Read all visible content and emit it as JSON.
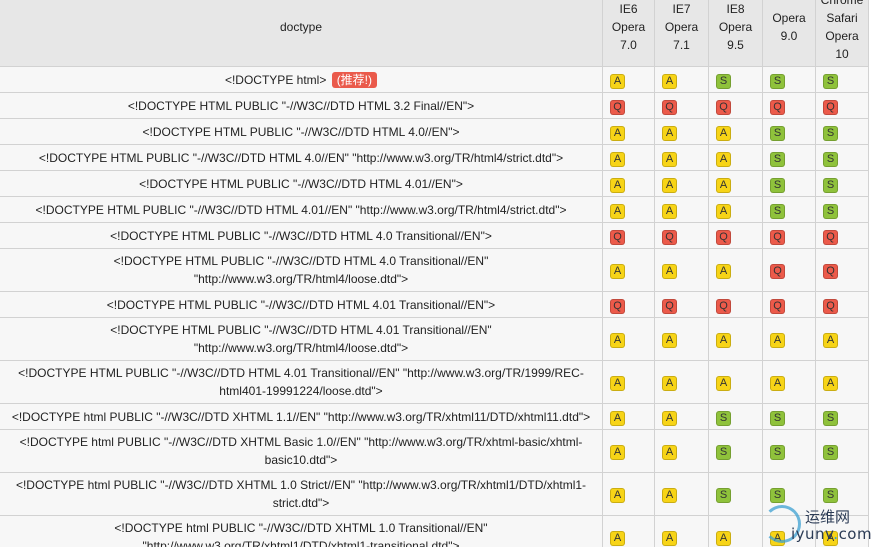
{
  "header": {
    "doctype": "doctype",
    "browsers": [
      {
        "top": "IE6",
        "line1": "Opera",
        "line2": "7.0",
        "line3": ""
      },
      {
        "top": "IE7",
        "line1": "Opera",
        "line2": "7.1",
        "line3": ""
      },
      {
        "top": "IE8",
        "line1": "Opera",
        "line2": "9.5",
        "line3": ""
      },
      {
        "top": "",
        "line1": "Opera",
        "line2": "9.0",
        "line3": ""
      },
      {
        "top": "Chrome",
        "line1": "Safari",
        "line2": "Opera",
        "line3": "10"
      }
    ]
  },
  "recommend_badge": "(推荐!)",
  "rows": [
    {
      "doctype": "<!DOCTYPE html>",
      "recommended": true,
      "modes": [
        "A",
        "A",
        "S",
        "S",
        "S"
      ]
    },
    {
      "doctype": "<!DOCTYPE HTML PUBLIC \"-//W3C//DTD HTML 3.2 Final//EN\">",
      "modes": [
        "Q",
        "Q",
        "Q",
        "Q",
        "Q"
      ]
    },
    {
      "doctype": "<!DOCTYPE HTML PUBLIC \"-//W3C//DTD HTML 4.0//EN\">",
      "modes": [
        "A",
        "A",
        "A",
        "S",
        "S"
      ]
    },
    {
      "doctype": "<!DOCTYPE HTML PUBLIC \"-//W3C//DTD HTML 4.0//EN\" \"http://www.w3.org/TR/html4/strict.dtd\">",
      "modes": [
        "A",
        "A",
        "A",
        "S",
        "S"
      ]
    },
    {
      "doctype": "<!DOCTYPE HTML PUBLIC \"-//W3C//DTD HTML 4.01//EN\">",
      "modes": [
        "A",
        "A",
        "A",
        "S",
        "S"
      ]
    },
    {
      "doctype": "<!DOCTYPE HTML PUBLIC \"-//W3C//DTD HTML 4.01//EN\" \"http://www.w3.org/TR/html4/strict.dtd\">",
      "modes": [
        "A",
        "A",
        "A",
        "S",
        "S"
      ]
    },
    {
      "doctype": "<!DOCTYPE HTML PUBLIC \"-//W3C//DTD HTML 4.0 Transitional//EN\">",
      "modes": [
        "Q",
        "Q",
        "Q",
        "Q",
        "Q"
      ]
    },
    {
      "doctype": "<!DOCTYPE HTML PUBLIC \"-//W3C//DTD HTML 4.0 Transitional//EN\" \"http://www.w3.org/TR/html4/loose.dtd\">",
      "doctype_lines": [
        "<!DOCTYPE HTML PUBLIC \"-//W3C//DTD HTML 4.0 Transitional//EN\"",
        "\"http://www.w3.org/TR/html4/loose.dtd\">"
      ],
      "modes": [
        "A",
        "A",
        "A",
        "Q",
        "Q"
      ]
    },
    {
      "doctype": "<!DOCTYPE HTML PUBLIC \"-//W3C//DTD HTML 4.01 Transitional//EN\">",
      "modes": [
        "Q",
        "Q",
        "Q",
        "Q",
        "Q"
      ]
    },
    {
      "doctype": "<!DOCTYPE HTML PUBLIC \"-//W3C//DTD HTML 4.01 Transitional//EN\" \"http://www.w3.org/TR/html4/loose.dtd\">",
      "doctype_lines": [
        "<!DOCTYPE HTML PUBLIC \"-//W3C//DTD HTML 4.01 Transitional//EN\"",
        "\"http://www.w3.org/TR/html4/loose.dtd\">"
      ],
      "modes": [
        "A",
        "A",
        "A",
        "A",
        "A"
      ]
    },
    {
      "doctype": "<!DOCTYPE HTML PUBLIC \"-//W3C//DTD HTML 4.01 Transitional//EN\" \"http://www.w3.org/TR/1999/REC-html401-19991224/loose.dtd\">",
      "doctype_lines": [
        "<!DOCTYPE HTML PUBLIC \"-//W3C//DTD HTML 4.01 Transitional//EN\" \"http://www.w3.org/TR/1999/REC-",
        "html401-19991224/loose.dtd\">"
      ],
      "modes": [
        "A",
        "A",
        "A",
        "A",
        "A"
      ]
    },
    {
      "doctype": "<!DOCTYPE html PUBLIC \"-//W3C//DTD XHTML 1.1//EN\" \"http://www.w3.org/TR/xhtml11/DTD/xhtml11.dtd\">",
      "modes": [
        "A",
        "A",
        "S",
        "S",
        "S"
      ]
    },
    {
      "doctype": "<!DOCTYPE html PUBLIC \"-//W3C//DTD XHTML Basic 1.0//EN\" \"http://www.w3.org/TR/xhtml-basic/xhtml-basic10.dtd\">",
      "doctype_lines": [
        "<!DOCTYPE html PUBLIC \"-//W3C//DTD XHTML Basic 1.0//EN\" \"http://www.w3.org/TR/xhtml-basic/xhtml-",
        "basic10.dtd\">"
      ],
      "modes": [
        "A",
        "A",
        "S",
        "S",
        "S"
      ]
    },
    {
      "doctype": "<!DOCTYPE html PUBLIC \"-//W3C//DTD XHTML 1.0 Strict//EN\" \"http://www.w3.org/TR/xhtml1/DTD/xhtml1-strict.dtd\">",
      "doctype_lines": [
        "<!DOCTYPE html PUBLIC \"-//W3C//DTD XHTML 1.0 Strict//EN\" \"http://www.w3.org/TR/xhtml1/DTD/xhtml1-",
        "strict.dtd\">"
      ],
      "modes": [
        "A",
        "A",
        "S",
        "S",
        "S"
      ]
    },
    {
      "doctype": "<!DOCTYPE html PUBLIC \"-//W3C//DTD XHTML 1.0 Transitional//EN\" \"http://www.w3.org/TR/xhtml1/DTD/xhtml1-transitional.dtd\">",
      "doctype_lines": [
        "<!DOCTYPE html PUBLIC \"-//W3C//DTD XHTML 1.0 Transitional//EN\"",
        "\"http://www.w3.org/TR/xhtml1/DTD/xhtml1-transitional.dtd\">"
      ],
      "modes": [
        "A",
        "A",
        "A",
        "A",
        "A"
      ]
    }
  ],
  "watermark": {
    "line1": "运维网",
    "line2_prefix": "iyunv",
    "line2_dot": ".",
    "line2_suffix": "com"
  },
  "colors": {
    "A": "#f7d417",
    "Q": "#ec5a4a",
    "S": "#8fc23b",
    "recommend": "#ea5a4b",
    "header_bg": "#e7e7e7",
    "row_bg": "#f7f7f7",
    "border": "#d2d2d2"
  }
}
